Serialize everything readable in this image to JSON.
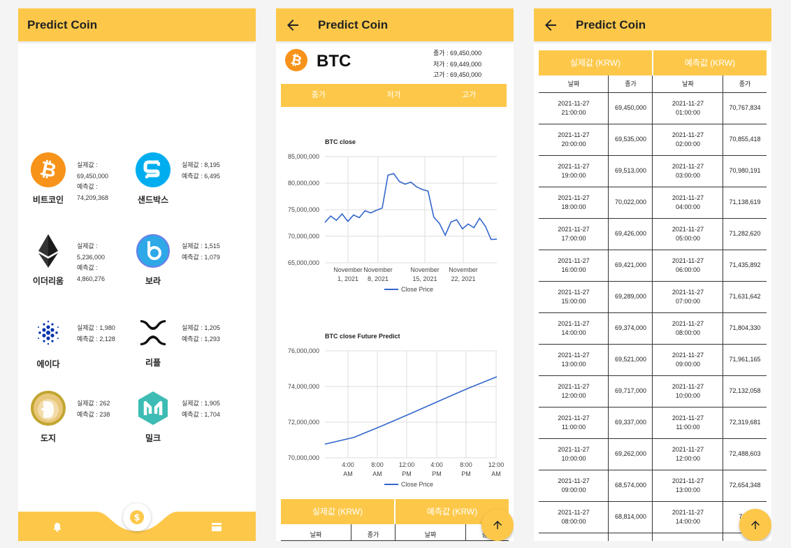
{
  "app_title": "Predict Coin",
  "coins": [
    {
      "name": "비트코인",
      "actual": "실제값 :\n69,450,000",
      "predicted": "예측값 :\n74,209,368",
      "icon": "bitcoin-icon"
    },
    {
      "name": "샌드박스",
      "actual": "실제값 : 8,195",
      "predicted": "예측값 : 6,495",
      "icon": "sandbox-icon"
    },
    {
      "name": "이더리움",
      "actual": "실제값 :\n5,236,000",
      "predicted": "예측값 :\n4,860,276",
      "icon": "ethereum-icon"
    },
    {
      "name": "보라",
      "actual": "실제값 : 1,515",
      "predicted": "예측값 : 1,079",
      "icon": "bora-icon"
    },
    {
      "name": "에이다",
      "actual": "실제값 : 1,980",
      "predicted": "예측값 : 2,128",
      "icon": "cardano-icon"
    },
    {
      "name": "리플",
      "actual": "실제값 : 1,205",
      "predicted": "예측값 : 1,293",
      "icon": "ripple-icon"
    },
    {
      "name": "도지",
      "actual": "실제값 : 262",
      "predicted": "예측값 : 238",
      "icon": "doge-icon"
    },
    {
      "name": "밀크",
      "actual": "실제값 : 1,905",
      "predicted": "예측값 : 1,704",
      "icon": "milk-icon"
    }
  ],
  "bottom_nav": {
    "left_icon": "bell-icon",
    "center_icon": "coin-icon",
    "right_icon": "card-icon"
  },
  "detail": {
    "symbol": "BTC",
    "close_line": "종가 : 69,450,000",
    "low_line": "저가 : 69,449,000",
    "high_line": "고가 : 69,450,000",
    "tabs": [
      "종가",
      "저가",
      "고가"
    ]
  },
  "colors": {
    "accent": "#fdc84a",
    "line": "#3366cc",
    "bitcoin": "#f7931a",
    "sandbox": "#00aeef",
    "bora": "#2fa8e8",
    "milk": "#3cbcb4"
  },
  "chart_data": [
    {
      "type": "line",
      "title": "BTC close",
      "x": [
        "2021-10-28",
        "2021-10-29",
        "2021-10-30",
        "2021-10-31",
        "2021-11-01",
        "2021-11-02",
        "2021-11-03",
        "2021-11-04",
        "2021-11-05",
        "2021-11-06",
        "2021-11-07",
        "2021-11-08",
        "2021-11-09",
        "2021-11-10",
        "2021-11-11",
        "2021-11-12",
        "2021-11-13",
        "2021-11-14",
        "2021-11-15",
        "2021-11-16",
        "2021-11-17",
        "2021-11-18",
        "2021-11-19",
        "2021-11-20",
        "2021-11-21",
        "2021-11-22",
        "2021-11-23",
        "2021-11-24",
        "2021-11-25",
        "2021-11-26",
        "2021-11-27"
      ],
      "xtick_labels": [
        "November\n1, 2021",
        "November\n8, 2021",
        "November\n15, 2021",
        "November\n22, 2021"
      ],
      "series": [
        {
          "name": "Close Price",
          "values": [
            72600000,
            73800000,
            73000000,
            74200000,
            72800000,
            74000000,
            73500000,
            74800000,
            74400000,
            74900000,
            75300000,
            81500000,
            81800000,
            80300000,
            79800000,
            80200000,
            79300000,
            78800000,
            78500000,
            73600000,
            72400000,
            70200000,
            72700000,
            73100000,
            71400000,
            72300000,
            71600000,
            73400000,
            71900000,
            69400000,
            69450000
          ]
        }
      ],
      "ylim": [
        65000000,
        85000000
      ],
      "yticks": [
        "85,000,000",
        "80,000,000",
        "75,000,000",
        "70,000,000",
        "65,000,000"
      ],
      "legend": "bottom",
      "grid": true
    },
    {
      "type": "line",
      "title": "BTC close Future Predict",
      "x": [
        "2021-11-28 01:00",
        "2021-11-28 04:00",
        "2021-11-28 08:00",
        "2021-11-28 12:00",
        "2021-11-28 16:00",
        "2021-11-28 20:00",
        "2021-11-29 00:00"
      ],
      "xtick_labels": [
        "4:00\nAM",
        "8:00\nAM",
        "12:00\nPM",
        "4:00\nPM",
        "8:00\nPM",
        "12:00\nAM"
      ],
      "series": [
        {
          "name": "Close Price",
          "values": [
            70770000,
            71140000,
            71800000,
            72490000,
            73200000,
            73900000,
            74550000
          ]
        }
      ],
      "ylim": [
        70000000,
        76000000
      ],
      "yticks": [
        "76,000,000",
        "74,000,000",
        "72,000,000",
        "70,000,000"
      ],
      "legend": "bottom",
      "grid": true
    }
  ],
  "table": {
    "group_headers": [
      "실제값 (KRW)",
      "예측값 (KRW)"
    ],
    "col_headers": [
      "날짜",
      "종가",
      "날짜",
      "종가"
    ],
    "rows": [
      [
        "2021-11-27\n21:00:00",
        "69,450,000",
        "2021-11-27\n01:00:00",
        "70,767,834"
      ],
      [
        "2021-11-27\n20:00:00",
        "69,535,000",
        "2021-11-27\n02:00:00",
        "70,855,418"
      ],
      [
        "2021-11-27\n19:00:00",
        "69,513,000",
        "2021-11-27\n03:00:00",
        "70,980,191"
      ],
      [
        "2021-11-27\n18:00:00",
        "70,022,000",
        "2021-11-27\n04:00:00",
        "71,138,619"
      ],
      [
        "2021-11-27\n17:00:00",
        "69,426,000",
        "2021-11-27\n05:00:00",
        "71,282,620"
      ],
      [
        "2021-11-27\n16:00:00",
        "69,421,000",
        "2021-11-27\n06:00:00",
        "71,435,892"
      ],
      [
        "2021-11-27\n15:00:00",
        "69,289,000",
        "2021-11-27\n07:00:00",
        "71,631,642"
      ],
      [
        "2021-11-27\n14:00:00",
        "69,374,000",
        "2021-11-27\n08:00:00",
        "71,804,330"
      ],
      [
        "2021-11-27\n13:00:00",
        "69,521,000",
        "2021-11-27\n09:00:00",
        "71,961,165"
      ],
      [
        "2021-11-27\n12:00:00",
        "69,717,000",
        "2021-11-27\n10:00:00",
        "72,132,058"
      ],
      [
        "2021-11-27\n11:00:00",
        "69,337,000",
        "2021-11-27\n11:00:00",
        "72,319,681"
      ],
      [
        "2021-11-27\n10:00:00",
        "69,262,000",
        "2021-11-27\n12:00:00",
        "72,488,603"
      ],
      [
        "2021-11-27\n09:00:00",
        "68,574,000",
        "2021-11-27\n13:00:00",
        "72,654,348"
      ],
      [
        "2021-11-27\n08:00:00",
        "68,814,000",
        "2021-11-27\n14:00:00",
        "72,8"
      ]
    ]
  }
}
